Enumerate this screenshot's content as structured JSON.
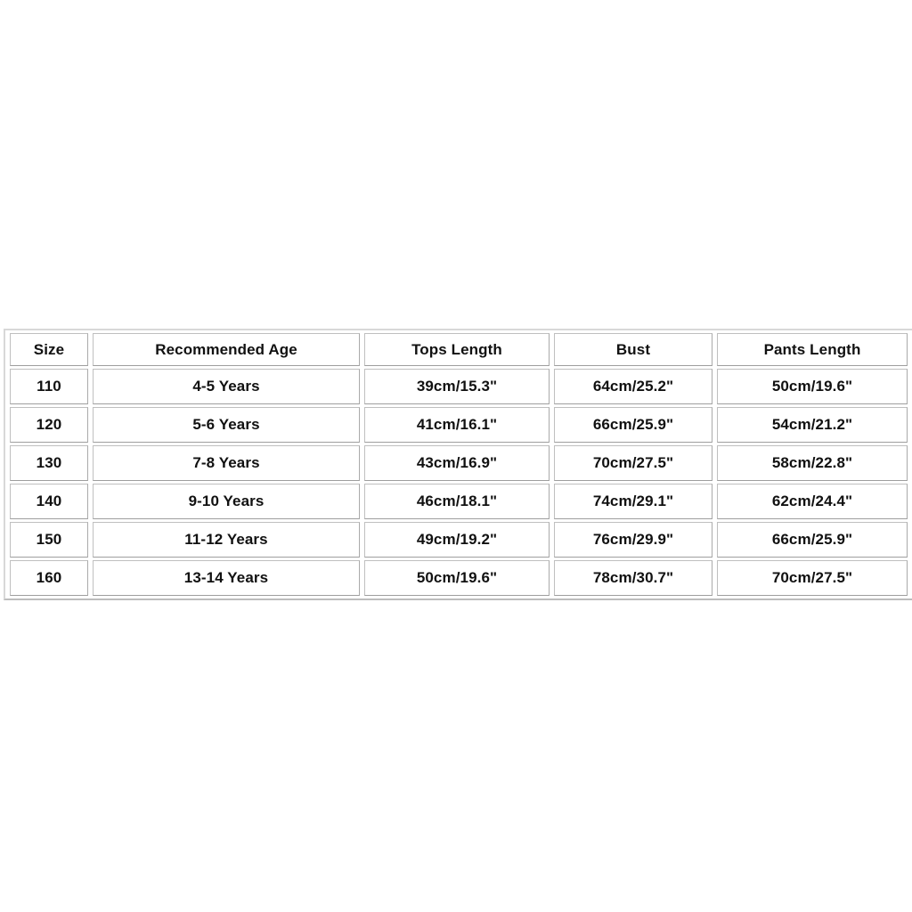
{
  "chart": {
    "columns": [
      {
        "key": "size",
        "label": "Size"
      },
      {
        "key": "age",
        "label": "Recommended Age"
      },
      {
        "key": "tops",
        "label": "Tops Length"
      },
      {
        "key": "bust",
        "label": "Bust"
      },
      {
        "key": "pants",
        "label": "Pants Length"
      }
    ],
    "rows": [
      {
        "size": "110",
        "age": "4-5 Years",
        "tops": "39cm/15.3\"",
        "bust": "64cm/25.2\"",
        "pants": "50cm/19.6\""
      },
      {
        "size": "120",
        "age": "5-6 Years",
        "tops": "41cm/16.1\"",
        "bust": "66cm/25.9\"",
        "pants": "54cm/21.2\""
      },
      {
        "size": "130",
        "age": "7-8 Years",
        "tops": "43cm/16.9\"",
        "bust": "70cm/27.5\"",
        "pants": "58cm/22.8\""
      },
      {
        "size": "140",
        "age": "9-10 Years",
        "tops": "46cm/18.1\"",
        "bust": "74cm/29.1\"",
        "pants": "62cm/24.4\""
      },
      {
        "size": "150",
        "age": "11-12 Years",
        "tops": "49cm/19.2\"",
        "bust": "76cm/29.9\"",
        "pants": "66cm/25.9\""
      },
      {
        "size": "160",
        "age": "13-14 Years",
        "tops": "50cm/19.6\"",
        "bust": "78cm/30.7\"",
        "pants": "70cm/27.5\""
      }
    ],
    "colors": {
      "background": "#ffffff",
      "cell_background": "#ffffff",
      "border": "#b4b4b4",
      "outer_border": "#c8c8c8",
      "text": "#111111"
    }
  }
}
